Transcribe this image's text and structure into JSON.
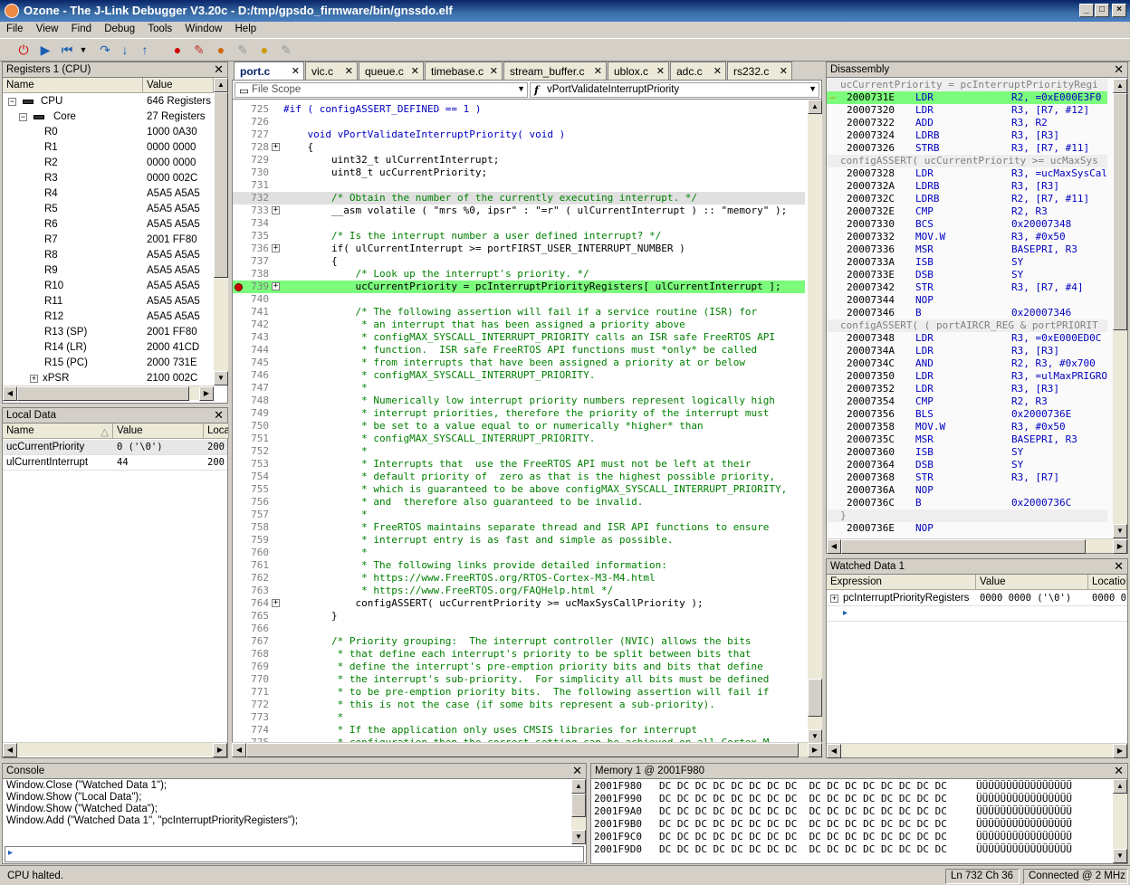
{
  "window": {
    "title": "Ozone - The J-Link Debugger V3.20c - D:/tmp/gpsdo_firmware/bin/gnssdo.elf"
  },
  "menu": [
    "File",
    "View",
    "Find",
    "Debug",
    "Tools",
    "Window",
    "Help"
  ],
  "registers": {
    "title": "Registers 1 (CPU)",
    "col_name": "Name",
    "col_value": "Value",
    "rows": [
      {
        "name": "CPU",
        "value": "646 Registers",
        "level": 0,
        "toggle": "−"
      },
      {
        "name": "Core",
        "value": "27 Registers",
        "level": 1,
        "toggle": "−"
      },
      {
        "name": "R0",
        "value": "1000 0A30",
        "level": 2
      },
      {
        "name": "R1",
        "value": "0000 0000",
        "level": 2
      },
      {
        "name": "R2",
        "value": "0000 0000",
        "level": 2
      },
      {
        "name": "R3",
        "value": "0000 002C",
        "level": 2
      },
      {
        "name": "R4",
        "value": "A5A5 A5A5",
        "level": 2
      },
      {
        "name": "R5",
        "value": "A5A5 A5A5",
        "level": 2
      },
      {
        "name": "R6",
        "value": "A5A5 A5A5",
        "level": 2
      },
      {
        "name": "R7",
        "value": "2001 FF80",
        "level": 2
      },
      {
        "name": "R8",
        "value": "A5A5 A5A5",
        "level": 2
      },
      {
        "name": "R9",
        "value": "A5A5 A5A5",
        "level": 2
      },
      {
        "name": "R10",
        "value": "A5A5 A5A5",
        "level": 2
      },
      {
        "name": "R11",
        "value": "A5A5 A5A5",
        "level": 2
      },
      {
        "name": "R12",
        "value": "A5A5 A5A5",
        "level": 2
      },
      {
        "name": "R13 (SP)",
        "value": "2001 FF80",
        "level": 2
      },
      {
        "name": "R14 (LR)",
        "value": "2000 41CD",
        "level": 2
      },
      {
        "name": "R15 (PC)",
        "value": "2000 731E",
        "level": 2
      },
      {
        "name": "xPSR",
        "value": "2100 002C",
        "level": 2,
        "toggle": "+"
      }
    ]
  },
  "local_data": {
    "title": "Local Data",
    "col_name": "Name",
    "col_value": "Value",
    "col_loc": "Loca",
    "rows": [
      {
        "name": "ucCurrentPriority",
        "value": "0  ('\\0')",
        "loc": "200"
      },
      {
        "name": "ulCurrentInterrupt",
        "value": "44",
        "loc": "200"
      }
    ]
  },
  "editor": {
    "tabs": [
      "port.c",
      "vic.c",
      "queue.c",
      "timebase.c",
      "stream_buffer.c",
      "ublox.c",
      "adc.c",
      "rs232.c"
    ],
    "active_tab": "port.c",
    "scope": "File Scope",
    "function": "vPortValidateInterruptPriority",
    "lines": [
      {
        "n": "725",
        "t": "#if ( configASSERT_DEFINED == 1 )",
        "c": "kw"
      },
      {
        "n": "726",
        "t": ""
      },
      {
        "n": "727",
        "t": "    void vPortValidateInterruptPriority( void )",
        "c": "kw"
      },
      {
        "n": "728",
        "t": "    {",
        "f": true
      },
      {
        "n": "729",
        "t": "        uint32_t ulCurrentInterrupt;"
      },
      {
        "n": "730",
        "t": "        uint8_t ucCurrentPriority;"
      },
      {
        "n": "731",
        "t": ""
      },
      {
        "n": "732",
        "t": "        /* Obtain the number of the currently executing interrupt. */",
        "c": "cm",
        "hl": "cursor"
      },
      {
        "n": "733",
        "t": "        __asm volatile ( \"mrs %0, ipsr\" : \"=r\" ( ulCurrentInterrupt ) :: \"memory\" );",
        "f": true
      },
      {
        "n": "734",
        "t": ""
      },
      {
        "n": "735",
        "t": "        /* Is the interrupt number a user defined interrupt? */",
        "c": "cm"
      },
      {
        "n": "736",
        "t": "        if( ulCurrentInterrupt >= portFIRST_USER_INTERRUPT_NUMBER )",
        "f": true
      },
      {
        "n": "737",
        "t": "        {"
      },
      {
        "n": "738",
        "t": "            /* Look up the interrupt's priority. */",
        "c": "cm"
      },
      {
        "n": "739",
        "t": "            ucCurrentPriority = pcInterruptPriorityRegisters[ ulCurrentInterrupt ];",
        "f": true,
        "hl": "pc"
      },
      {
        "n": "740",
        "t": ""
      },
      {
        "n": "741",
        "t": "            /* The following assertion will fail if a service routine (ISR) for",
        "c": "cm"
      },
      {
        "n": "742",
        "t": "             * an interrupt that has been assigned a priority above",
        "c": "cm"
      },
      {
        "n": "743",
        "t": "             * configMAX_SYSCALL_INTERRUPT_PRIORITY calls an ISR safe FreeRTOS API",
        "c": "cm"
      },
      {
        "n": "744",
        "t": "             * function.  ISR safe FreeRTOS API functions must *only* be called",
        "c": "cm"
      },
      {
        "n": "745",
        "t": "             * from interrupts that have been assigned a priority at or below",
        "c": "cm"
      },
      {
        "n": "746",
        "t": "             * configMAX_SYSCALL_INTERRUPT_PRIORITY.",
        "c": "cm"
      },
      {
        "n": "747",
        "t": "             *",
        "c": "cm"
      },
      {
        "n": "748",
        "t": "             * Numerically low interrupt priority numbers represent logically high",
        "c": "cm"
      },
      {
        "n": "749",
        "t": "             * interrupt priorities, therefore the priority of the interrupt must",
        "c": "cm"
      },
      {
        "n": "750",
        "t": "             * be set to a value equal to or numerically *higher* than",
        "c": "cm"
      },
      {
        "n": "751",
        "t": "             * configMAX_SYSCALL_INTERRUPT_PRIORITY.",
        "c": "cm"
      },
      {
        "n": "752",
        "t": "             *",
        "c": "cm"
      },
      {
        "n": "753",
        "t": "             * Interrupts that  use the FreeRTOS API must not be left at their",
        "c": "cm"
      },
      {
        "n": "754",
        "t": "             * default priority of  zero as that is the highest possible priority,",
        "c": "cm"
      },
      {
        "n": "755",
        "t": "             * which is guaranteed to be above configMAX_SYSCALL_INTERRUPT_PRIORITY,",
        "c": "cm"
      },
      {
        "n": "756",
        "t": "             * and  therefore also guaranteed to be invalid.",
        "c": "cm"
      },
      {
        "n": "757",
        "t": "             *",
        "c": "cm"
      },
      {
        "n": "758",
        "t": "             * FreeRTOS maintains separate thread and ISR API functions to ensure",
        "c": "cm"
      },
      {
        "n": "759",
        "t": "             * interrupt entry is as fast and simple as possible.",
        "c": "cm"
      },
      {
        "n": "760",
        "t": "             *",
        "c": "cm"
      },
      {
        "n": "761",
        "t": "             * The following links provide detailed information:",
        "c": "cm"
      },
      {
        "n": "762",
        "t": "             * https://www.FreeRTOS.org/RTOS-Cortex-M3-M4.html",
        "c": "cm"
      },
      {
        "n": "763",
        "t": "             * https://www.FreeRTOS.org/FAQHelp.html */",
        "c": "cm"
      },
      {
        "n": "764",
        "t": "            configASSERT( ucCurrentPriority >= ucMaxSysCallPriority );",
        "f": true
      },
      {
        "n": "765",
        "t": "        }"
      },
      {
        "n": "766",
        "t": ""
      },
      {
        "n": "767",
        "t": "        /* Priority grouping:  The interrupt controller (NVIC) allows the bits",
        "c": "cm"
      },
      {
        "n": "768",
        "t": "         * that define each interrupt's priority to be split between bits that",
        "c": "cm"
      },
      {
        "n": "769",
        "t": "         * define the interrupt's pre-emption priority bits and bits that define",
        "c": "cm"
      },
      {
        "n": "770",
        "t": "         * the interrupt's sub-priority.  For simplicity all bits must be defined",
        "c": "cm"
      },
      {
        "n": "771",
        "t": "         * to be pre-emption priority bits.  The following assertion will fail if",
        "c": "cm"
      },
      {
        "n": "772",
        "t": "         * this is not the case (if some bits represent a sub-priority).",
        "c": "cm"
      },
      {
        "n": "773",
        "t": "         *",
        "c": "cm"
      },
      {
        "n": "774",
        "t": "         * If the application only uses CMSIS libraries for interrupt",
        "c": "cm"
      },
      {
        "n": "775",
        "t": "         * configuration then the correct setting can be achieved on all Cortex-M",
        "c": "cm"
      }
    ]
  },
  "disassembly": {
    "title": "Disassembly",
    "lines": [
      {
        "src": "ucCurrentPriority = pcInterruptPriorityRegi"
      },
      {
        "a": "2000731E",
        "m": "LDR",
        "o": "R2, =0xE000E3F0",
        "cur": true
      },
      {
        "a": "20007320",
        "m": "LDR",
        "o": "R3, [R7, #12]"
      },
      {
        "a": "20007322",
        "m": "ADD",
        "o": "R3, R2"
      },
      {
        "a": "20007324",
        "m": "LDRB",
        "o": "R3, [R3]"
      },
      {
        "a": "20007326",
        "m": "STRB",
        "o": "R3, [R7, #11]"
      },
      {
        "src": "configASSERT( ucCurrentPriority >= ucMaxSys"
      },
      {
        "a": "20007328",
        "m": "LDR",
        "o": "R3, =ucMaxSysCal"
      },
      {
        "a": "2000732A",
        "m": "LDRB",
        "o": "R3, [R3]"
      },
      {
        "a": "2000732C",
        "m": "LDRB",
        "o": "R2, [R7, #11]"
      },
      {
        "a": "2000732E",
        "m": "CMP",
        "o": "R2, R3"
      },
      {
        "a": "20007330",
        "m": "BCS",
        "o": "0x20007348"
      },
      {
        "a": "20007332",
        "m": "MOV.W",
        "o": "R3, #0x50"
      },
      {
        "a": "20007336",
        "m": "MSR",
        "o": "BASEPRI, R3"
      },
      {
        "a": "2000733A",
        "m": "ISB",
        "o": "SY"
      },
      {
        "a": "2000733E",
        "m": "DSB",
        "o": "SY"
      },
      {
        "a": "20007342",
        "m": "STR",
        "o": "R3, [R7, #4]"
      },
      {
        "a": "20007344",
        "m": "NOP",
        "o": ""
      },
      {
        "a": "20007346",
        "m": "B",
        "o": "0x20007346"
      },
      {
        "src": "configASSERT( ( portAIRCR_REG & portPRIORIT"
      },
      {
        "a": "20007348",
        "m": "LDR",
        "o": "R3, =0xE000ED0C"
      },
      {
        "a": "2000734A",
        "m": "LDR",
        "o": "R3, [R3]"
      },
      {
        "a": "2000734C",
        "m": "AND",
        "o": "R2, R3, #0x700"
      },
      {
        "a": "20007350",
        "m": "LDR",
        "o": "R3, =ulMaxPRIGRO"
      },
      {
        "a": "20007352",
        "m": "LDR",
        "o": "R3, [R3]"
      },
      {
        "a": "20007354",
        "m": "CMP",
        "o": "R2, R3"
      },
      {
        "a": "20007356",
        "m": "BLS",
        "o": "0x2000736E"
      },
      {
        "a": "20007358",
        "m": "MOV.W",
        "o": "R3, #0x50"
      },
      {
        "a": "2000735C",
        "m": "MSR",
        "o": "BASEPRI, R3"
      },
      {
        "a": "20007360",
        "m": "ISB",
        "o": "SY"
      },
      {
        "a": "20007364",
        "m": "DSB",
        "o": "SY"
      },
      {
        "a": "20007368",
        "m": "STR",
        "o": "R3, [R7]"
      },
      {
        "a": "2000736A",
        "m": "NOP",
        "o": ""
      },
      {
        "a": "2000736C",
        "m": "B",
        "o": "0x2000736C"
      },
      {
        "src": "}"
      },
      {
        "a": "2000736E",
        "m": "NOP",
        "o": ""
      }
    ]
  },
  "watched": {
    "title": "Watched Data 1",
    "col_expr": "Expression",
    "col_value": "Value",
    "col_loc": "Location",
    "rows": [
      {
        "expr": "pcInterruptPriorityRegisters",
        "value": "0000 0000  ('\\0')",
        "loc": "0000 0"
      }
    ]
  },
  "console": {
    "title": "Console",
    "lines": [
      "Window.Close (\"Watched Data 1\");",
      "Window.Show (\"Local Data\");",
      "Window.Show (\"Watched Data\");",
      "Window.Add (\"Watched Data 1\", \"pcInterruptPriorityRegisters\");"
    ]
  },
  "memory": {
    "title": "Memory 1 @ 2001F980",
    "rows": [
      {
        "addr": "2001F980",
        "bytes": "DC DC DC DC DC DC DC DC  DC DC DC DC DC DC DC DC",
        "ascii": "ÜÜÜÜÜÜÜÜÜÜÜÜÜÜÜÜ"
      },
      {
        "addr": "2001F990",
        "bytes": "DC DC DC DC DC DC DC DC  DC DC DC DC DC DC DC DC",
        "ascii": "ÜÜÜÜÜÜÜÜÜÜÜÜÜÜÜÜ"
      },
      {
        "addr": "2001F9A0",
        "bytes": "DC DC DC DC DC DC DC DC  DC DC DC DC DC DC DC DC",
        "ascii": "ÜÜÜÜÜÜÜÜÜÜÜÜÜÜÜÜ"
      },
      {
        "addr": "2001F9B0",
        "bytes": "DC DC DC DC DC DC DC DC  DC DC DC DC DC DC DC DC",
        "ascii": "ÜÜÜÜÜÜÜÜÜÜÜÜÜÜÜÜ"
      },
      {
        "addr": "2001F9C0",
        "bytes": "DC DC DC DC DC DC DC DC  DC DC DC DC DC DC DC DC",
        "ascii": "ÜÜÜÜÜÜÜÜÜÜÜÜÜÜÜÜ"
      },
      {
        "addr": "2001F9D0",
        "bytes": "DC DC DC DC DC DC DC DC  DC DC DC DC DC DC DC DC",
        "ascii": "ÜÜÜÜÜÜÜÜÜÜÜÜÜÜÜÜ"
      }
    ]
  },
  "status": {
    "left": "CPU halted.",
    "pos": "Ln 732  Ch 36",
    "conn": "Connected @ 2 MHz"
  },
  "colors": {
    "pc_highlight": "#7cfc7c",
    "cursor_line": "#e0e0e0",
    "title_bar": "#0a246a"
  }
}
